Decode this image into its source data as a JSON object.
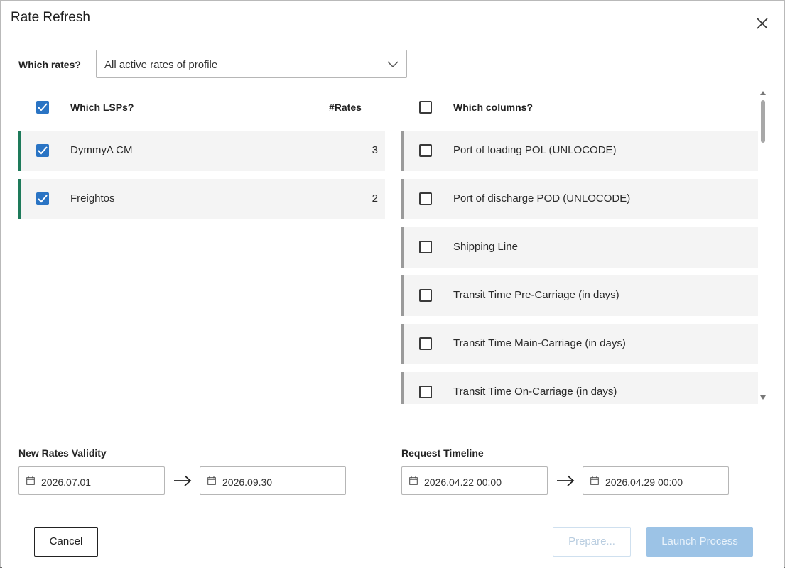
{
  "dialog": {
    "title": "Rate Refresh",
    "which_rates_label": "Which rates?",
    "which_rates_value": "All active rates of profile"
  },
  "lsps": {
    "header": "Which LSPs?",
    "count_header": "#Rates",
    "items": [
      {
        "name": "DymmyA CM",
        "count": "3"
      },
      {
        "name": "Freightos",
        "count": "2"
      }
    ]
  },
  "columns": {
    "header": "Which columns?",
    "items": [
      "Port of loading POL (UNLOCODE)",
      "Port of discharge POD (UNLOCODE)",
      "Shipping Line",
      "Transit Time Pre-Carriage (in days)",
      "Transit Time Main-Carriage (in days)",
      "Transit Time On-Carriage (in days)"
    ]
  },
  "validity": {
    "label": "New Rates Validity",
    "from": "2026.07.01",
    "to": "2026.09.30"
  },
  "timeline": {
    "label": "Request Timeline",
    "from": "2026.04.22 00:00",
    "to": "2026.04.29 00:00"
  },
  "footer": {
    "cancel": "Cancel",
    "prepare": "Prepare...",
    "launch": "Launch Process"
  },
  "colors": {
    "accent": "#2a74c4",
    "lsp_bar": "#1e7a5a",
    "column_bar": "#9a9a9a",
    "launch_disabled": "#9cc3e6"
  }
}
